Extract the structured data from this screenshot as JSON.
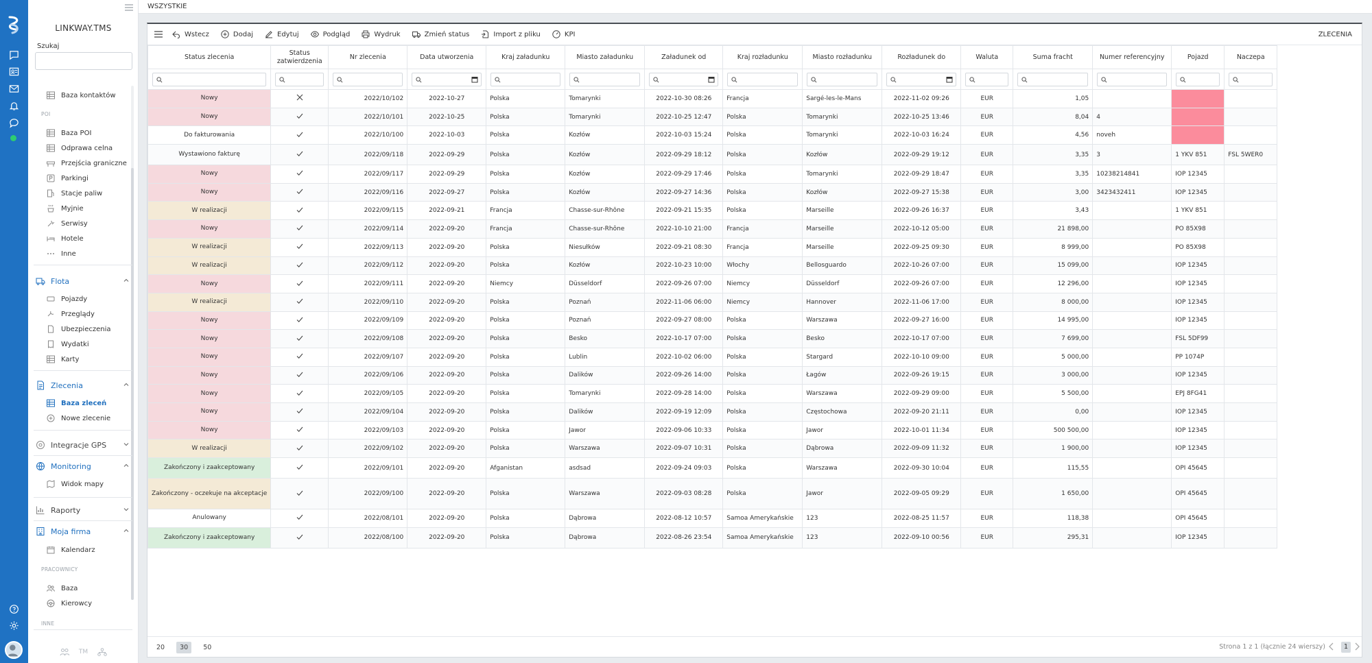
{
  "app": {
    "brand": "LINKWAY.TMS"
  },
  "colors": {
    "accent": "#1f72c3",
    "status_red": "#f6d9dd",
    "status_yellow": "#f4ead6",
    "status_green": "#d9efdc",
    "pink_cell": "#fb8c9c"
  },
  "rail_icons": [
    "chat-icon",
    "contacts-icon",
    "mail-icon",
    "bell-icon",
    "comment-icon",
    "online-status-icon",
    "help-icon",
    "settings-icon"
  ],
  "sidebar": {
    "search_label": "Szukaj",
    "search_placeholder": "",
    "top_items": [
      {
        "label": "Baza kontaktów",
        "icon": "table-icon"
      }
    ],
    "poi_label": "POI",
    "poi_items": [
      {
        "label": "Baza POI",
        "icon": "table-icon"
      },
      {
        "label": "Odprawa celna",
        "icon": "table-icon"
      },
      {
        "label": "Przejścia graniczne",
        "icon": "barrier-icon"
      },
      {
        "label": "Parkingi",
        "icon": "parking-icon"
      },
      {
        "label": "Stacje paliw",
        "icon": "fuel-icon"
      },
      {
        "label": "Myjnie",
        "icon": "wash-icon"
      },
      {
        "label": "Serwisy",
        "icon": "wrench-icon"
      },
      {
        "label": "Hotele",
        "icon": "bed-icon"
      },
      {
        "label": "Inne",
        "icon": "more-icon"
      }
    ],
    "flota": {
      "label": "Flota",
      "items": [
        {
          "label": "Pojazdy"
        },
        {
          "label": "Przeglądy"
        },
        {
          "label": "Ubezpieczenia"
        },
        {
          "label": "Wydatki"
        },
        {
          "label": "Karty"
        }
      ]
    },
    "zlecenia": {
      "label": "Zlecenia",
      "items": [
        {
          "label": "Baza zleceń"
        },
        {
          "label": "Nowe zlecenie"
        }
      ]
    },
    "integracje": {
      "label": "Integracje GPS"
    },
    "monitoring": {
      "label": "Monitoring",
      "items": [
        {
          "label": "Widok mapy"
        }
      ]
    },
    "raporty": {
      "label": "Raporty"
    },
    "moja_firma": {
      "label": "Moja firma",
      "items": [
        {
          "label": "Kalendarz"
        }
      ]
    },
    "pracownicy_label": "PRACOWNICY",
    "pracownicy_items": [
      {
        "label": "Baza"
      },
      {
        "label": "Kierowcy"
      }
    ],
    "inne_label": "INNE",
    "bottom_text": "TM"
  },
  "topbar": {
    "title": "WSZYSTKIE"
  },
  "toolbar": {
    "buttons": [
      {
        "label": "Wstecz",
        "icon": "back-icon"
      },
      {
        "label": "Dodaj",
        "icon": "plus-circle-icon"
      },
      {
        "label": "Edytuj",
        "icon": "edit-icon"
      },
      {
        "label": "Podgląd",
        "icon": "eye-icon"
      },
      {
        "label": "Wydruk",
        "icon": "printer-icon"
      },
      {
        "label": "Zmień status",
        "icon": "truck-icon"
      },
      {
        "label": "Import z pliku",
        "icon": "file-import-icon"
      },
      {
        "label": "KPI",
        "icon": "gauge-icon"
      }
    ],
    "right_label": "ZLECENIA"
  },
  "table": {
    "columns": [
      "Status zlecenia",
      "Status zatwierdzenia",
      "Nr zlecenia",
      "Data utworzenia",
      "Kraj załadunku",
      "Miasto załadunku",
      "Załadunek od",
      "Kraj rozładunku",
      "Miasto rozładunku",
      "Rozładunek do",
      "Waluta",
      "Suma fracht",
      "Numer referencyjny",
      "Pojazd",
      "Naczepa"
    ],
    "rows": [
      {
        "status": "Nowy",
        "status_color": "red",
        "approval": "x",
        "nr": "2022/10/102",
        "created": "2022-10-27",
        "load_country": "Polska",
        "load_city": "Tomarynki",
        "load_from": "2022-10-30 08:26",
        "unload_country": "Francja",
        "unload_city": "Sargé-les-le-Mans",
        "unload_to": "2022-11-02 09:26",
        "currency": "EUR",
        "sum": "1,05",
        "ref": "",
        "vehicle": "",
        "vehicle_pink": true,
        "trailer": ""
      },
      {
        "status": "Nowy",
        "status_color": "red",
        "approval": "check",
        "nr": "2022/10/101",
        "created": "2022-10-25",
        "load_country": "Polska",
        "load_city": "Tomarynki",
        "load_from": "2022-10-25 12:47",
        "unload_country": "Polska",
        "unload_city": "Tomarynki",
        "unload_to": "2022-10-25 13:46",
        "currency": "EUR",
        "sum": "8,04",
        "ref": "4",
        "vehicle": "",
        "vehicle_pink": true,
        "trailer": ""
      },
      {
        "status": "Do fakturowania",
        "status_color": "",
        "approval": "check",
        "nr": "2022/10/100",
        "created": "2022-10-03",
        "load_country": "Polska",
        "load_city": "Kozłów",
        "load_from": "2022-10-03 15:24",
        "unload_country": "Polska",
        "unload_city": "Tomarynki",
        "unload_to": "2022-10-03 16:24",
        "currency": "EUR",
        "sum": "4,56",
        "ref": "noveh",
        "vehicle": "",
        "vehicle_pink": true,
        "trailer": ""
      },
      {
        "status": "Wystawiono fakturę",
        "status_color": "",
        "approval": "check",
        "nr": "2022/09/118",
        "created": "2022-09-29",
        "load_country": "Polska",
        "load_city": "Kozłów",
        "load_from": "2022-09-29 18:12",
        "unload_country": "Polska",
        "unload_city": "Kozłów",
        "unload_to": "2022-09-29 19:12",
        "currency": "EUR",
        "sum": "3,35",
        "ref": "3",
        "vehicle": "1 YKV 851",
        "vehicle_pink": false,
        "trailer": "FSL 5WER0"
      },
      {
        "status": "Nowy",
        "status_color": "red",
        "approval": "check",
        "nr": "2022/09/117",
        "created": "2022-09-29",
        "load_country": "Polska",
        "load_city": "Kozłów",
        "load_from": "2022-09-29 17:46",
        "unload_country": "Polska",
        "unload_city": "Tomarynki",
        "unload_to": "2022-09-29 18:47",
        "currency": "EUR",
        "sum": "3,35",
        "ref": "10238214841",
        "vehicle": "IOP 12345",
        "vehicle_pink": false,
        "trailer": ""
      },
      {
        "status": "Nowy",
        "status_color": "red",
        "approval": "check",
        "nr": "2022/09/116",
        "created": "2022-09-27",
        "load_country": "Polska",
        "load_city": "Kozłów",
        "load_from": "2022-09-27 14:36",
        "unload_country": "Polska",
        "unload_city": "Kozłów",
        "unload_to": "2022-09-27 15:38",
        "currency": "EUR",
        "sum": "3,00",
        "ref": "3423432411",
        "vehicle": "IOP 12345",
        "vehicle_pink": false,
        "trailer": ""
      },
      {
        "status": "W realizacji",
        "status_color": "yel",
        "approval": "check",
        "nr": "2022/09/115",
        "created": "2022-09-21",
        "load_country": "Francja",
        "load_city": "Chasse-sur-Rhône",
        "load_from": "2022-09-21 15:35",
        "unload_country": "Polska",
        "unload_city": "Marseille",
        "unload_to": "2022-09-26 16:37",
        "currency": "EUR",
        "sum": "3,43",
        "ref": "",
        "vehicle": "1 YKV 851",
        "vehicle_pink": false,
        "trailer": ""
      },
      {
        "status": "Nowy",
        "status_color": "red",
        "approval": "check",
        "nr": "2022/09/114",
        "created": "2022-09-20",
        "load_country": "Francja",
        "load_city": "Chasse-sur-Rhône",
        "load_from": "2022-10-10 21:00",
        "unload_country": "Francja",
        "unload_city": "Marseille",
        "unload_to": "2022-10-12 05:00",
        "currency": "EUR",
        "sum": "21 898,00",
        "ref": "",
        "vehicle": "PO 85X98",
        "vehicle_pink": false,
        "trailer": ""
      },
      {
        "status": "W realizacji",
        "status_color": "yel",
        "approval": "check",
        "nr": "2022/09/113",
        "created": "2022-09-20",
        "load_country": "Polska",
        "load_city": "Niesułków",
        "load_from": "2022-09-21 08:30",
        "unload_country": "Francja",
        "unload_city": "Marseille",
        "unload_to": "2022-09-25 09:30",
        "currency": "EUR",
        "sum": "8 999,00",
        "ref": "",
        "vehicle": "PO 85X98",
        "vehicle_pink": false,
        "trailer": ""
      },
      {
        "status": "W realizacji",
        "status_color": "yel",
        "approval": "check",
        "nr": "2022/09/112",
        "created": "2022-09-20",
        "load_country": "Polska",
        "load_city": "Kozłów",
        "load_from": "2022-10-23 10:00",
        "unload_country": "Włochy",
        "unload_city": "Bellosguardo",
        "unload_to": "2022-10-26 07:00",
        "currency": "EUR",
        "sum": "15 099,00",
        "ref": "",
        "vehicle": "IOP 12345",
        "vehicle_pink": false,
        "trailer": ""
      },
      {
        "status": "Nowy",
        "status_color": "red",
        "approval": "check",
        "nr": "2022/09/111",
        "created": "2022-09-20",
        "load_country": "Niemcy",
        "load_city": "Düsseldorf",
        "load_from": "2022-09-26 07:00",
        "unload_country": "Niemcy",
        "unload_city": "Düsseldorf",
        "unload_to": "2022-09-26 07:00",
        "currency": "EUR",
        "sum": "12 296,00",
        "ref": "",
        "vehicle": "IOP 12345",
        "vehicle_pink": false,
        "trailer": ""
      },
      {
        "status": "W realizacji",
        "status_color": "yel",
        "approval": "check",
        "nr": "2022/09/110",
        "created": "2022-09-20",
        "load_country": "Polska",
        "load_city": "Poznań",
        "load_from": "2022-11-06 06:00",
        "unload_country": "Niemcy",
        "unload_city": "Hannover",
        "unload_to": "2022-11-06 17:00",
        "currency": "EUR",
        "sum": "8 000,00",
        "ref": "",
        "vehicle": "IOP 12345",
        "vehicle_pink": false,
        "trailer": ""
      },
      {
        "status": "Nowy",
        "status_color": "red",
        "approval": "check",
        "nr": "2022/09/109",
        "created": "2022-09-20",
        "load_country": "Polska",
        "load_city": "Poznań",
        "load_from": "2022-09-27 08:00",
        "unload_country": "Polska",
        "unload_city": "Warszawa",
        "unload_to": "2022-09-27 16:00",
        "currency": "EUR",
        "sum": "14 995,00",
        "ref": "",
        "vehicle": "IOP 12345",
        "vehicle_pink": false,
        "trailer": ""
      },
      {
        "status": "Nowy",
        "status_color": "red",
        "approval": "check",
        "nr": "2022/09/108",
        "created": "2022-09-20",
        "load_country": "Polska",
        "load_city": "Besko",
        "load_from": "2022-10-17 07:00",
        "unload_country": "Polska",
        "unload_city": "Besko",
        "unload_to": "2022-10-17 07:00",
        "currency": "EUR",
        "sum": "7 699,00",
        "ref": "",
        "vehicle": "FSL 5DF99",
        "vehicle_pink": false,
        "trailer": ""
      },
      {
        "status": "Nowy",
        "status_color": "red",
        "approval": "check",
        "nr": "2022/09/107",
        "created": "2022-09-20",
        "load_country": "Polska",
        "load_city": "Lublin",
        "load_from": "2022-10-02 06:00",
        "unload_country": "Polska",
        "unload_city": "Stargard",
        "unload_to": "2022-10-10 09:00",
        "currency": "EUR",
        "sum": "5 000,00",
        "ref": "",
        "vehicle": "PP 1074P",
        "vehicle_pink": false,
        "trailer": ""
      },
      {
        "status": "Nowy",
        "status_color": "red",
        "approval": "check",
        "nr": "2022/09/106",
        "created": "2022-09-20",
        "load_country": "Polska",
        "load_city": "Dalików",
        "load_from": "2022-09-26 14:00",
        "unload_country": "Polska",
        "unload_city": "Łagów",
        "unload_to": "2022-09-26 19:15",
        "currency": "EUR",
        "sum": "3 000,00",
        "ref": "",
        "vehicle": "IOP 12345",
        "vehicle_pink": false,
        "trailer": ""
      },
      {
        "status": "Nowy",
        "status_color": "red",
        "approval": "check",
        "nr": "2022/09/105",
        "created": "2022-09-20",
        "load_country": "Polska",
        "load_city": "Tomarynki",
        "load_from": "2022-09-28 14:00",
        "unload_country": "Polska",
        "unload_city": "Warszawa",
        "unload_to": "2022-09-29 09:00",
        "currency": "EUR",
        "sum": "5 500,00",
        "ref": "",
        "vehicle": "EPJ 8FG41",
        "vehicle_pink": false,
        "trailer": ""
      },
      {
        "status": "Nowy",
        "status_color": "red",
        "approval": "check",
        "nr": "2022/09/104",
        "created": "2022-09-20",
        "load_country": "Polska",
        "load_city": "Dalików",
        "load_from": "2022-09-19 12:09",
        "unload_country": "Polska",
        "unload_city": "Częstochowa",
        "unload_to": "2022-09-20 21:11",
        "currency": "EUR",
        "sum": "0,00",
        "ref": "",
        "vehicle": "IOP 12345",
        "vehicle_pink": false,
        "trailer": ""
      },
      {
        "status": "Nowy",
        "status_color": "red",
        "approval": "check",
        "nr": "2022/09/103",
        "created": "2022-09-20",
        "load_country": "Polska",
        "load_city": "Jawor",
        "load_from": "2022-09-06 10:33",
        "unload_country": "Polska",
        "unload_city": "Jawor",
        "unload_to": "2022-10-01 11:34",
        "currency": "EUR",
        "sum": "500 500,00",
        "ref": "",
        "vehicle": "IOP 12345",
        "vehicle_pink": false,
        "trailer": ""
      },
      {
        "status": "W realizacji",
        "status_color": "yel",
        "approval": "check",
        "nr": "2022/09/102",
        "created": "2022-09-20",
        "load_country": "Polska",
        "load_city": "Warszawa",
        "load_from": "2022-09-07 10:31",
        "unload_country": "Polska",
        "unload_city": "Dąbrowa",
        "unload_to": "2022-09-09 11:32",
        "currency": "EUR",
        "sum": "1 900,00",
        "ref": "",
        "vehicle": "IOP 12345",
        "vehicle_pink": false,
        "trailer": ""
      },
      {
        "status": "Zakończony i zaakceptowany",
        "status_color": "grn",
        "approval": "check",
        "nr": "2022/09/101",
        "created": "2022-09-20",
        "load_country": "Afganistan",
        "load_city": "asdsad",
        "load_from": "2022-09-24 09:03",
        "unload_country": "Polska",
        "unload_city": "Warszawa",
        "unload_to": "2022-09-30 10:04",
        "currency": "EUR",
        "sum": "115,55",
        "ref": "",
        "vehicle": "OPI 45645",
        "vehicle_pink": false,
        "trailer": ""
      },
      {
        "status": "Zakończony - oczekuje na akceptacje",
        "status_color": "yel",
        "approval": "check",
        "nr": "2022/09/100",
        "created": "2022-09-20",
        "load_country": "Polska",
        "load_city": "Warszawa",
        "load_from": "2022-09-03 08:28",
        "unload_country": "Polska",
        "unload_city": "Jawor",
        "unload_to": "2022-09-05 09:29",
        "currency": "EUR",
        "sum": "1 650,00",
        "ref": "",
        "vehicle": "OPI 45645",
        "vehicle_pink": false,
        "trailer": ""
      },
      {
        "status": "Anulowany",
        "status_color": "",
        "approval": "check",
        "nr": "2022/08/101",
        "created": "2022-09-20",
        "load_country": "Polska",
        "load_city": "Dąbrowa",
        "load_from": "2022-08-12 10:57",
        "unload_country": "Samoa Amerykańskie",
        "unload_city": "123",
        "unload_to": "2022-08-25 11:57",
        "currency": "EUR",
        "sum": "118,38",
        "ref": "",
        "vehicle": "OPI 45645",
        "vehicle_pink": false,
        "trailer": ""
      },
      {
        "status": "Zakończony i zaakceptowany",
        "status_color": "grn",
        "approval": "check",
        "nr": "2022/08/100",
        "created": "2022-09-20",
        "load_country": "Polska",
        "load_city": "Dąbrowa",
        "load_from": "2022-08-26 23:54",
        "unload_country": "Samoa Amerykańskie",
        "unload_city": "123",
        "unload_to": "2022-09-10 00:56",
        "currency": "EUR",
        "sum": "295,31",
        "ref": "",
        "vehicle": "IOP 12345",
        "vehicle_pink": false,
        "trailer": ""
      }
    ]
  },
  "pagination": {
    "sizes": [
      "20",
      "30",
      "50"
    ],
    "selected": "30",
    "info": "Strona 1 z 1 (łącznie 24 wierszy)",
    "current_page": "1"
  }
}
